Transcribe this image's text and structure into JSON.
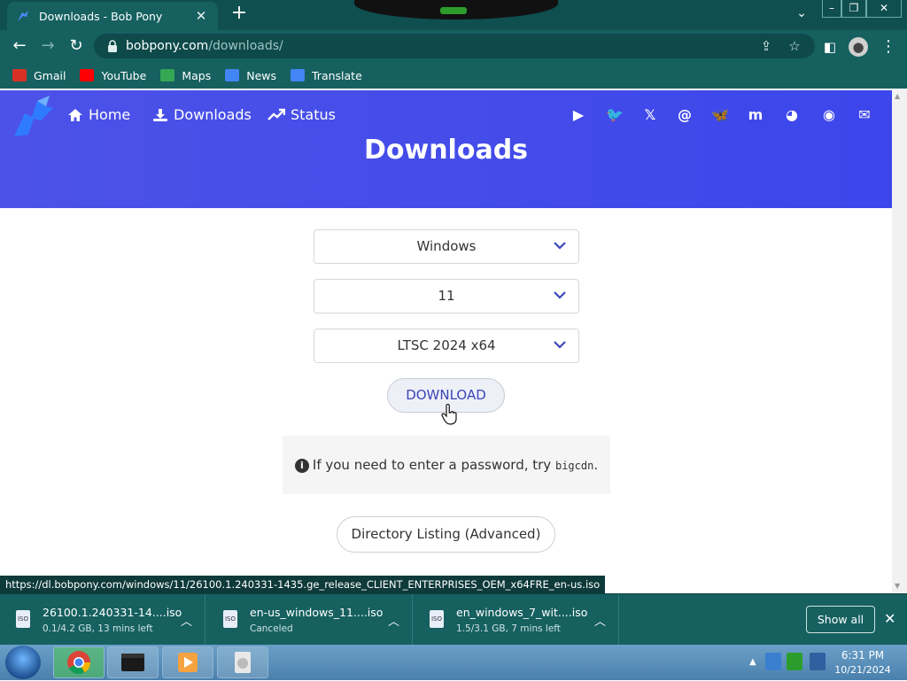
{
  "browser": {
    "tab_title": "Downloads - Bob Pony",
    "tab_close": "✕",
    "new_tab": "+",
    "url_host": "bobpony.com",
    "url_path": "/downloads/",
    "bookmarks": [
      {
        "label": "Gmail",
        "icon": "gmail-icon",
        "color": "#d93025"
      },
      {
        "label": "YouTube",
        "icon": "youtube-icon",
        "color": "#ff0000"
      },
      {
        "label": "Maps",
        "icon": "maps-icon",
        "color": "#34a853"
      },
      {
        "label": "News",
        "icon": "news-icon",
        "color": "#4285f4"
      },
      {
        "label": "Translate",
        "icon": "translate-icon",
        "color": "#4285f4"
      }
    ]
  },
  "site": {
    "nav": [
      {
        "label": "Home",
        "icon": "home-icon"
      },
      {
        "label": "Downloads",
        "icon": "download-icon"
      },
      {
        "label": "Status",
        "icon": "trend-icon"
      }
    ],
    "social_icons": [
      "youtube-icon",
      "twitter-icon",
      "x-icon",
      "threads-icon",
      "bluesky-icon",
      "mastodon-icon",
      "discord-icon",
      "github-icon",
      "email-icon"
    ],
    "hero_title": "Downloads",
    "accent_color": "#4c52e8"
  },
  "form": {
    "os": "Windows",
    "version": "11",
    "edition": "LTSC 2024 x64",
    "download_label": "DOWNLOAD",
    "info_text": "If you need to enter a password, try",
    "info_code": "bigcdn",
    "info_end": ".",
    "directory_label": "Directory Listing (Advanced)"
  },
  "status_bar_url": "https://dl.bobpony.com/windows/11/26100.1.240331-1435.ge_release_CLIENT_ENTERPRISES_OEM_x64FRE_en-us.iso",
  "downloads": [
    {
      "name": "26100.1.240331-14....iso",
      "status": "0.1/4.2 GB, 13 mins left"
    },
    {
      "name": "en-us_windows_11....iso",
      "status": "Canceled"
    },
    {
      "name": "en_windows_7_wit....iso",
      "status": "1.5/3.1 GB, 7 mins left"
    }
  ],
  "shelf": {
    "show_all": "Show all"
  },
  "taskbar": {
    "time": "6:31 PM",
    "date": "10/21/2024"
  }
}
